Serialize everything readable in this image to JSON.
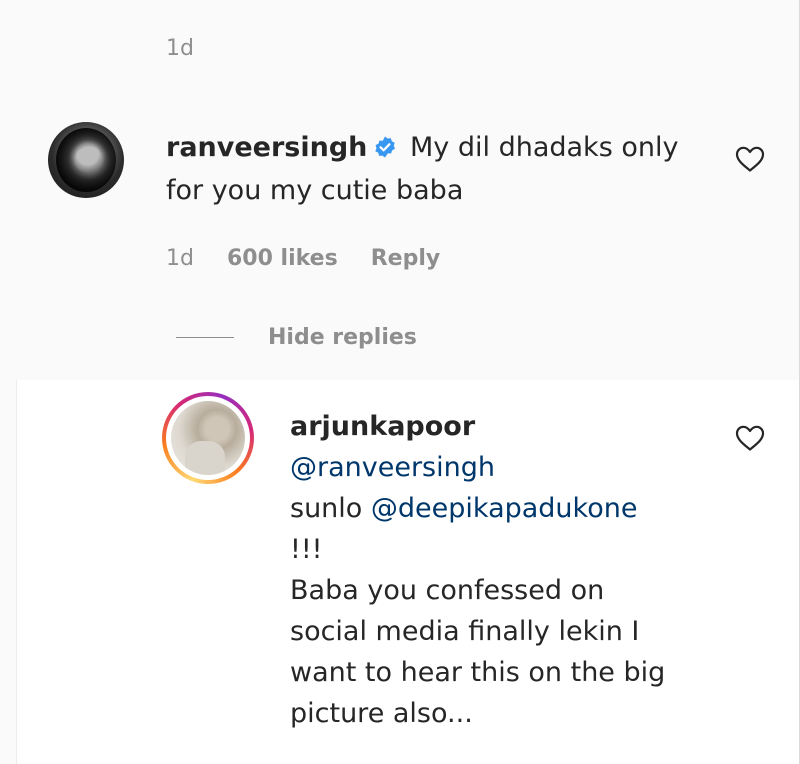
{
  "thread": {
    "top_timestamp": "1d",
    "hide_replies_label": "Hide replies"
  },
  "comment": {
    "username": "ranveersingh",
    "verified": true,
    "text_line1": "My dil dhadaks only",
    "text_line2": "for you my cutie baba",
    "timestamp": "1d",
    "likes": "600 likes",
    "reply_label": "Reply"
  },
  "reply": {
    "username": "arjunkapoor",
    "mention_1": "@ranveersingh",
    "text_prefix": "sunlo ",
    "mention_2": "@deepikapadukone",
    "line_exclaim": "!!!",
    "line_1": "Baba you confessed on",
    "line_2": "social media finally lekin I",
    "line_3": "want to hear this on the big",
    "line_4": "picture also..."
  },
  "icons": {
    "verified": "verified-badge-icon",
    "like": "heart-outline-icon"
  },
  "colors": {
    "verified_blue": "#3897f0",
    "mention_blue": "#00376b",
    "muted_gray": "#8e8e8e",
    "text": "#262626"
  }
}
